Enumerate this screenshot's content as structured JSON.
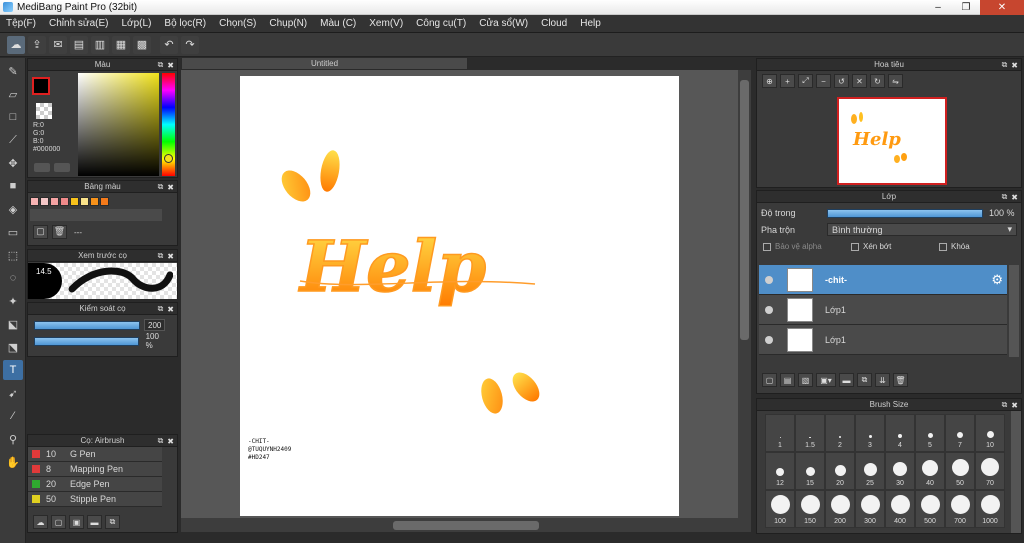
{
  "window": {
    "title": "MediBang Paint Pro (32bit)",
    "controls": [
      "–",
      "❐",
      "✕"
    ]
  },
  "menu": [
    "Tệp(F)",
    "Chỉnh sửa(E)",
    "Lớp(L)",
    "Bộ lọc(R)",
    "Chọn(S)",
    "Chụp(N)",
    "Màu (C)",
    "Xem(V)",
    "Công cụ(T)",
    "Cửa sổ(W)",
    "Cloud",
    "Help"
  ],
  "toolbar": {
    "icons": [
      "cloud-icon",
      "share-icon",
      "chat-icon",
      "document-icon",
      "page-icon",
      "grid-icon",
      "tiles-icon",
      "undo-icon",
      "redo-icon"
    ]
  },
  "left_tools": [
    "brush-icon",
    "eraser-icon",
    "rectangle-icon",
    "dot-icon",
    "move-icon",
    "fill-rect-icon",
    "bucket-icon",
    "gradient-icon",
    "select-rect-icon",
    "lasso-icon",
    "magic-wand-icon",
    "select-pen-icon",
    "select-eraser-icon",
    "text-icon",
    "operation-icon",
    "dropper-icon",
    "pipette-icon",
    "hand-icon"
  ],
  "color_panel": {
    "title": "Màu",
    "r": "R:0",
    "g": "G:0",
    "b": "B:0",
    "hex": "#000000",
    "fg": "#000000",
    "bg": "#ffffff"
  },
  "palette_panel": {
    "title": "Bảng màu",
    "swatches": [
      "#f7b3b3",
      "#f4c7c7",
      "#f5a3a3",
      "#f08a8a",
      "#f7c21b",
      "#fbe38a",
      "#f7921a",
      "#f47a1a"
    ],
    "label": "---"
  },
  "brush_preview": {
    "title": "Xem trước cọ",
    "size": "14.5"
  },
  "brush_control": {
    "title": "Kiểm soát cọ",
    "size": "200",
    "opacity": "100 %"
  },
  "brush_panel": {
    "title": "Cọ: Airbrush",
    "items": [
      {
        "size": "10",
        "name": "G Pen",
        "color": "#e03a3a"
      },
      {
        "size": "8",
        "name": "Mapping Pen",
        "color": "#e03a3a"
      },
      {
        "size": "20",
        "name": "Edge Pen",
        "color": "#2fa82f"
      },
      {
        "size": "50",
        "name": "Stipple Pen",
        "color": "#e0d020"
      }
    ]
  },
  "document": {
    "tab": "Untitled",
    "watermark": [
      "-CHIT-",
      "@TUQUYNH2409",
      "#HD247"
    ],
    "art_text": "Help"
  },
  "navigator": {
    "title": "Hoa tiêu"
  },
  "layers": {
    "title": "Lớp",
    "opacity_label": "Độ trong",
    "opacity_value": "100 %",
    "blend_label": "Pha trộn",
    "blend_value": "Bình thường",
    "protect_alpha": "Bảo vệ alpha",
    "clipping": "Xén bớt",
    "lock": "Khóa",
    "items": [
      {
        "name": "-chit-",
        "selected": true
      },
      {
        "name": "Lớp1",
        "selected": false
      },
      {
        "name": "Lớp1",
        "selected": false
      }
    ]
  },
  "brush_size": {
    "title": "Brush Size",
    "sizes": [
      "1",
      "1.5",
      "2",
      "3",
      "4",
      "5",
      "7",
      "10",
      "12",
      "15",
      "20",
      "25",
      "30",
      "40",
      "50",
      "70",
      "100",
      "150",
      "200",
      "300",
      "400",
      "500",
      "700",
      "1000"
    ]
  }
}
